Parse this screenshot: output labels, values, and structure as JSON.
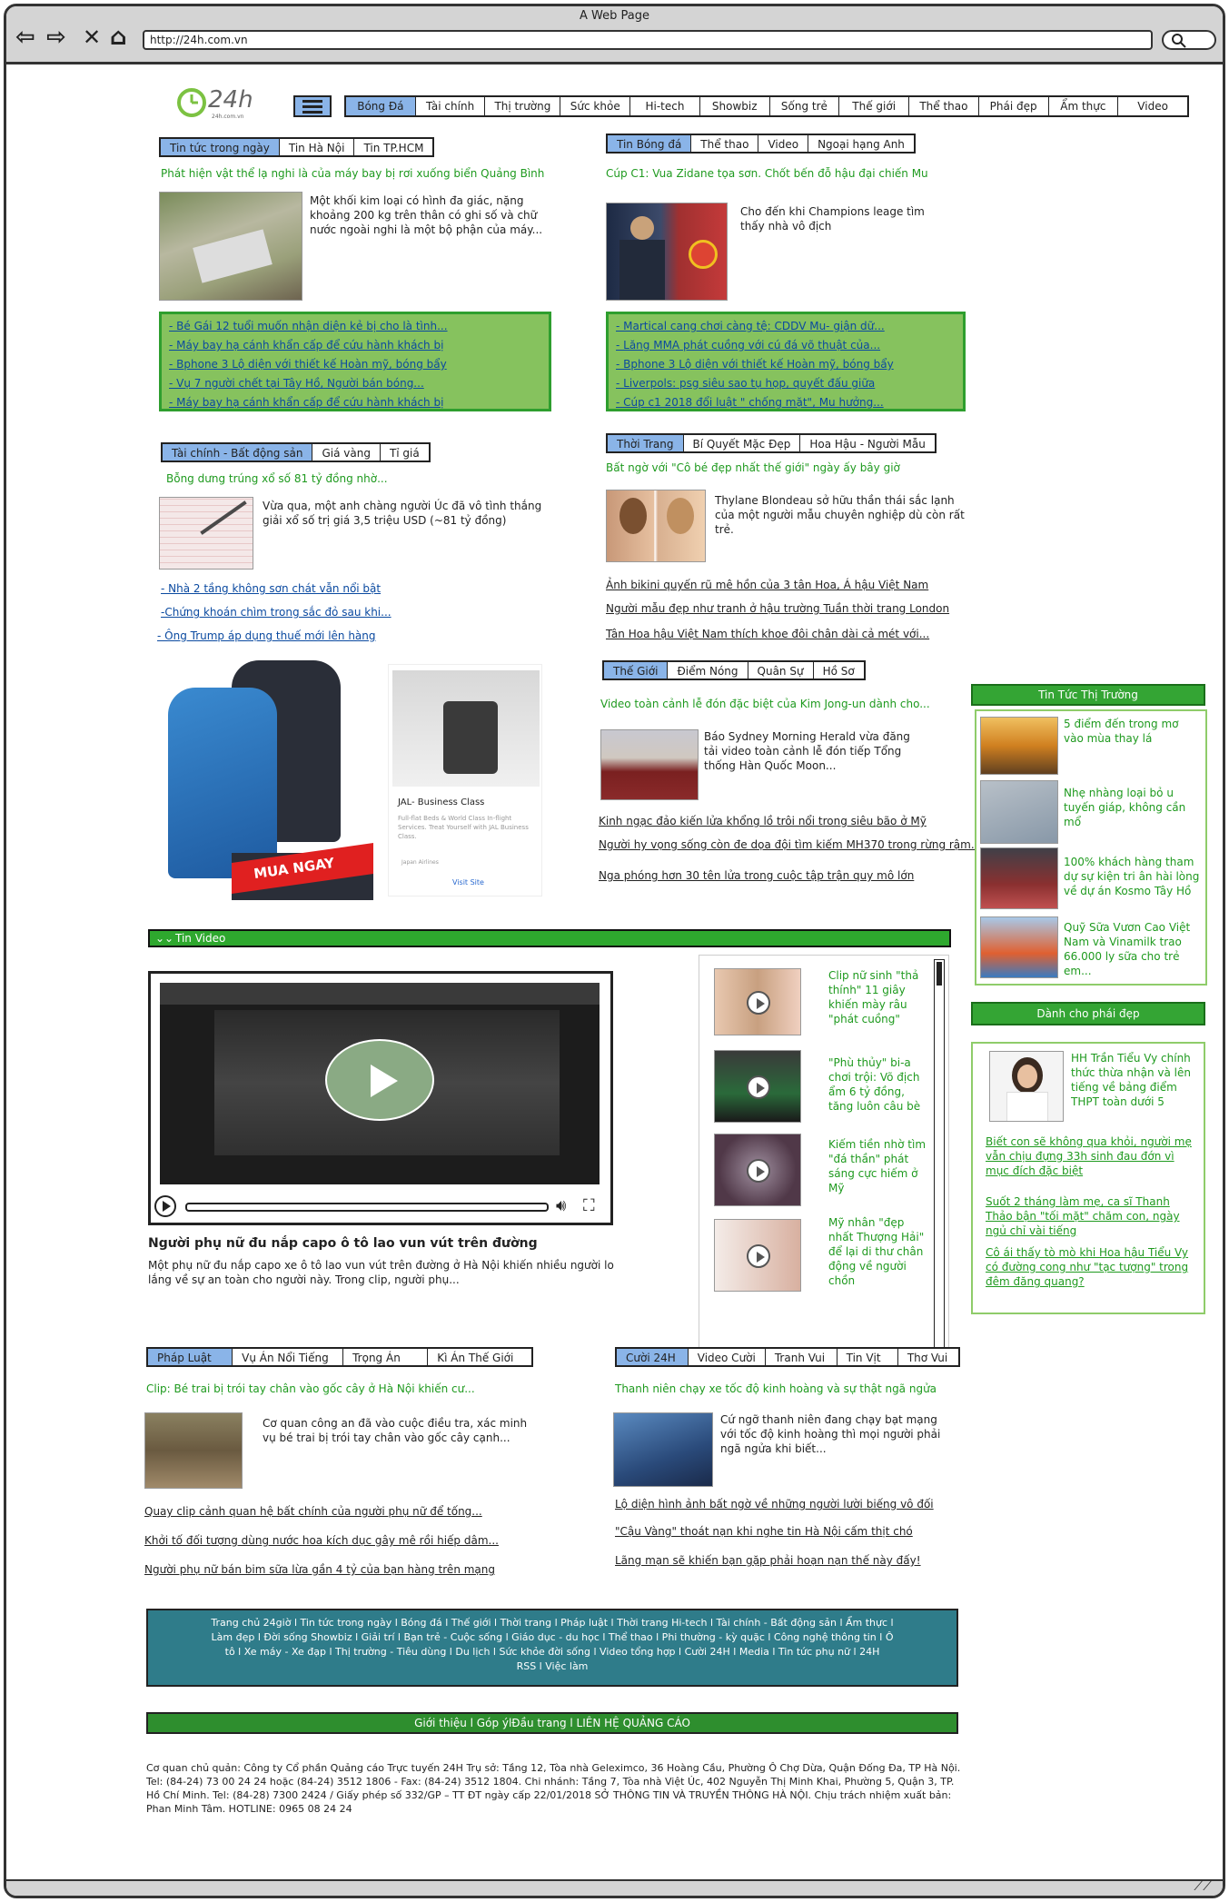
{
  "window": {
    "title": "A Web Page",
    "url": "http://24h.com.vn"
  },
  "logo": {
    "text": "24h",
    "subtext": "24h.com.vn"
  },
  "nav": {
    "items": [
      "Bóng Đá",
      "Tài chính",
      "Thị trường",
      "Sức khỏe",
      "Hi-tech",
      "Showbiz",
      "Sống trẻ",
      "Thế giới",
      "Thể thao",
      "Phái đẹp",
      "Ẩm thực",
      "Video"
    ]
  },
  "news": {
    "tabs": [
      "Tin tức trong ngày",
      "Tin Hà Nội",
      "Tin TP.HCM"
    ],
    "headline": "Phát hiện vật thể lạ nghi là của máy bay bị rơi xuống biển Quảng Bình",
    "summary": "Một khối kim loại có hình đa giác, nặng khoảng 200 kg trên thân có ghi số và chữ nước ngoài nghi là một bộ phận của máy...",
    "links": [
      "- Bé Gái 12 tuổi muốn nhận diện kẻ bị cho là tình...",
      "- Máy bay hạ cánh khẩn cấp để cứu hành khách bị",
      "- Bphone 3 Lộ diện với thiết kế Hoàn mỹ, bóng bẩy",
      "- Vụ 7 người chết tại Tây Hồ, Người bán bóng...",
      "- Máy bay hạ cánh khẩn cấp để cứu hành khách bị"
    ]
  },
  "football": {
    "tabs": [
      "Tin Bóng đá",
      "Thể thao",
      "Video",
      "Ngoại hạng Anh"
    ],
    "headline": "Cúp C1: Vua Zidane tọa sơn. Chốt bến đỗ hậu đại chiến Mu",
    "summary": "Cho đến khi Champions leage tìm thấy nhà vô địch",
    "links": [
      "- Martical cang chơi càng tệ: CDDV Mu- giận dữ...",
      "- Lăng MMA phát cuồng với cú đá võ thuật của...",
      "- Bphone 3 Lộ diện với thiết kế Hoàn mỹ, bóng bẩy",
      "- Liverpols: psg siêu sao tụ họp, quyết đấu giữa",
      "- Cúp c1 2018 đổi luật \" chống mặt\", Mu hưởng..."
    ]
  },
  "finance": {
    "tabs": [
      "Tài chính - Bất động sản",
      "Giá vàng",
      "Tỉ giá"
    ],
    "headline": "Bỗng dưng trúng xổ số 81 tỷ đồng nhờ...",
    "summary": "Vừa qua, một anh chàng người Úc đã vô tình thắng giải xổ số trị giá 3,5 triệu USD (~81 tỷ đồng)",
    "links": [
      "- Nhà 2 tầng không sơn chát vẫn nổi bật",
      "-Chứng khoán chìm trong sắc đỏ sau khi...",
      "- Ông Trump áp dụng thuế mới lên hàng"
    ]
  },
  "fashion": {
    "tabs": [
      "Thời Trang",
      "Bí Quyết Mặc Đẹp",
      "Hoa Hậu - Người Mẫu"
    ],
    "headline": "Bất ngờ với \"Cô bé đẹp nhất thế giới\" ngày ấy bây giờ",
    "summary": "Thylane Blondeau sở hữu thần thái sắc lạnh của một người mẫu chuyên nghiệp dù còn rất trẻ.",
    "links": [
      "Ảnh bikini quyến rũ mê hồn của 3 tân Hoa, Á hậu Việt Nam",
      "Người mẫu đẹp như tranh ở hậu trường Tuần thời trang London",
      "Tân Hoa hậu Việt Nam thích khoe đôi chân dài cả mét với..."
    ]
  },
  "ads": {
    "buy_now": "MUA NGAY",
    "ad_title": "JAL- Business Class",
    "ad_body": "Full-flat Beds & World Class In-flight Services. Treat Yourself with JAL Business Class.",
    "ad_brand": "Japan Airlines",
    "visit": "Visit Site"
  },
  "world": {
    "tabs": [
      "Thế Giới",
      "Điểm Nóng",
      "Quân Sự",
      "Hồ Sơ"
    ],
    "headline": "Video toàn cảnh lễ đón đặc biệt của Kim Jong-un dành cho...",
    "summary": "Báo Sydney Morning Herald vừa đăng tải video toàn cảnh lễ đón tiếp Tổng thống Hàn Quốc Moon...",
    "links": [
      "Kinh ngạc đảo kiến lửa khổng lồ trôi nổi trong siêu bão ở Mỹ",
      "Người hy vọng sống còn đe dọa đội tìm kiếm MH370 trong rừng rậm...",
      "Nga phóng hơn 30 tên lửa trong cuộc tập trận quy mô lớn"
    ]
  },
  "market": {
    "header": "Tin Tức Thị Trường",
    "items": [
      "5 điểm đến trong mơ vào mùa thay lá",
      "Nhẹ nhàng loại bỏ u tuyến giáp, không cần mổ",
      "100% khách hàng tham dự sự kiện tri ân hài lòng về dự án Kosmo Tây Hồ",
      "Quỹ Sữa Vươn Cao Việt Nam và Vinamilk trao 66.000 ly sữa cho trẻ em..."
    ]
  },
  "ladies": {
    "header": "Dành cho phái đẹp",
    "feature": "HH Trần Tiểu Vy chính thức thừa nhận và lên tiếng về bảng điểm THPT toàn dưới 5",
    "links": [
      "Biết con sẽ không qua khỏi, người mẹ vẫn chịu đựng 33h sinh đau đớn vì mục đích đặc biệt",
      "Suốt 2 tháng làm mẹ, ca sĩ Thanh Thảo bận \"tối mặt\" chăm con, ngày ngủ chỉ vài tiếng",
      "Cô ái thấy tò mò khi Hoa hậu Tiểu Vy có đường cong như \"tạc tượng\" trong đêm đăng quang?"
    ]
  },
  "video": {
    "header": "Tin Video",
    "title": "Người phụ nữ đu nắp capo ô tô lao vun vút trên đường",
    "desc": "Một phụ nữ đu nắp capo xe ô tô lao vun vút trên đường ở Hà Nội khiến nhiều người lo lắng về sự an toàn cho người này. Trong clip, người phụ...",
    "playlist": [
      "Clip nữ sinh \"thả thính\" 11 giây khiến mày râu \"phát cuồng\"",
      "\"Phù thủy\" bi-a chơi trội: Võ địch ẩm 6 tỷ đồng, tăng luôn câu bè",
      "Kiếm tiền nhờ tìm \"đá thần\" phát sáng cực hiếm ở Mỹ",
      "Mỹ nhân \"đẹp nhất Thượng Hải\" để lại di thư chân động về người chồn"
    ]
  },
  "law": {
    "tabs": [
      "Pháp Luật",
      "Vụ Án Nổi Tiếng",
      "Trọng Án",
      "Kì Án Thế Giới"
    ],
    "headline": "Clip: Bé trai bị trói tay chân vào gốc cây ở Hà Nội khiến cư...",
    "summary": "Cơ quan công an đã vào cuộc điều tra, xác minh vụ bé trai bị trói tay chân vào gốc cây cạnh...",
    "links": [
      "Quay clip cảnh quan hệ bất chính của người phụ nữ để tống...",
      "Khởi tố đối tượng dùng nước hoa kích dục gây mê rồi hiếp dâm...",
      "Người phụ nữ bán bim sữa lừa gần 4 tỷ của bạn hàng trên mạng"
    ]
  },
  "fun": {
    "tabs": [
      "Cười 24H",
      "Video Cười",
      "Tranh Vui",
      "Tin Vịt",
      "Thơ Vui"
    ],
    "headline": "Thanh niên chạy xe tốc độ kinh hoàng và sự thật ngã ngửa",
    "summary": "Cứ ngỡ thanh niên đang chạy bạt mạng với tốc độ kinh hoàng thì mọi người phải ngã ngửa khi biết...",
    "links": [
      "Lộ diện hình ảnh bất ngờ về những người lười biếng vô đối",
      "\"Cậu Vàng\" thoát nạn khi nghe tin Hà Nội cấm thịt chó",
      "Lãng mạn sẽ khiến bạn gặp phải hoạn nạn thế này đấy!"
    ]
  },
  "footer": {
    "links_lines": [
      "Trang chủ 24giờ l  Tin tức trong ngày l  Bóng đá l  Thế giới l  Thời trang l  Pháp luật l  Thời trang Hi-tech l  Tài chính - Bất động sản l  Ẩm thực l",
      "Làm đẹp l  Đời sống Showbiz l  Giải trí l  Bạn trẻ - Cuộc sống l  Giáo dục - du học l  Thể thao l  Phi thường - kỳ quặc l  Công nghệ thông tin l  Ô",
      "tô l  Xe máy - Xe đạp l  Thị trường - Tiêu dùng l  Du lịch l  Sức khỏe đời sống l  Video tổng hợp l  Cười 24H l  Media l  Tin tức phụ nữ l  24H",
      "RSS l  Việc làm"
    ],
    "bar": "Giới thiệu l Góp ýlĐầu trang l LIÊN HỆ QUẢNG CÁO",
    "info": "Cơ quan chủ quản: Công ty Cổ phần Quảng cáo Trực tuyến 24H Trụ sở: Tầng 12, Tòa nhà Geleximco, 36 Hoàng Cầu, Phường Ô Chợ Dừa, Quận Đống Đa, TP Hà Nội. Tel: (84-24) 73 00 24 24 hoặc (84-24) 3512 1806 - Fax: (84-24) 3512 1804. Chi nhánh: Tầng 7, Tòa nhà Việt Úc, 402 Nguyễn Thị Minh Khai, Phường 5, Quận 3, TP. Hồ Chí Minh. Tel: (84-28) 7300 2424 / Giấy phép số 332/GP – TT ĐT ngày cấp 22/01/2018 SỞ THÔNG TIN VÀ TRUYỀN THÔNG HÀ NỘI. Chịu trách nhiệm xuất bản: Phan Minh Tâm. HOTLINE: 0965 08 24 24"
  }
}
